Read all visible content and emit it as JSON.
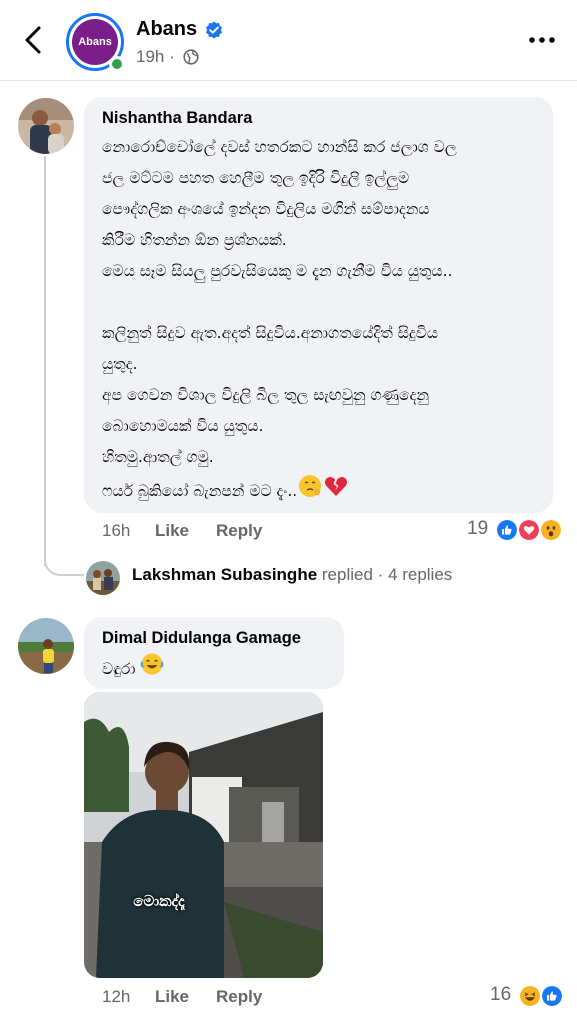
{
  "header": {
    "page_name": "Abans",
    "avatar_text": "Abans",
    "time": "19h ·",
    "back_icon": "back-arrow-icon",
    "more_icon": "more-horizontal-icon",
    "audience_icon": "globe-icon"
  },
  "comments": [
    {
      "author": "Nishantha Bandara",
      "text": "නොරොච්චෝලේ දවස් හතරකට හාන්සි කර ජලාශ වල\nජල මට්ටම පහත හෙලීම තුල ඉදිරි විදුලි ඉල්ලුම\nපෞද්ගලික අංශයේ ඉන්දන විදුලිය මගින් සම්පාදනය\nකිරීම හිතන්න ඕන ප්‍රශ්නයක්.\nමෙය සෑම සියලු පුරවැසියෙකු ම දැන ගැනීම විය යුතුය..\n\nකලිනුත් සිදුව ඇත.අදත් සිදුවිය.අනාගතයේදිත් සිදුවිය\nයුතුද.\nඅප ගෙවන විශාල විදුලි බිල තුල සැඟවුනු ගණුදෙනු\nබොහොමයක් විය යුතුය.\nහිතමු.ආතල් ගමු.\nෆයර් බුකියෝ බැනපන් මට දැං..",
      "time": "16h",
      "like": "Like",
      "reply": "Reply",
      "reaction_count": "19",
      "reactions": [
        "like",
        "love",
        "wow"
      ]
    },
    {
      "author": "Dimal Didulanga Gamage",
      "text": "වඳුරා",
      "time": "12h",
      "like": "Like",
      "reply": "Reply",
      "reaction_count": "16",
      "reactions": [
        "haha",
        "like"
      ],
      "video_caption": "මොකද්දෑ"
    }
  ],
  "replies_summary": {
    "name": "Lakshman Subasinghe",
    "rest": " replied · 4 replies"
  },
  "colors": {
    "brand_blue": "#1877f2",
    "online_green": "#31a24c",
    "bubble_bg": "#f0f2f5",
    "secondary_text": "#65676b",
    "love_red": "#f33e58",
    "reaction_yellow": "#f7b125"
  }
}
